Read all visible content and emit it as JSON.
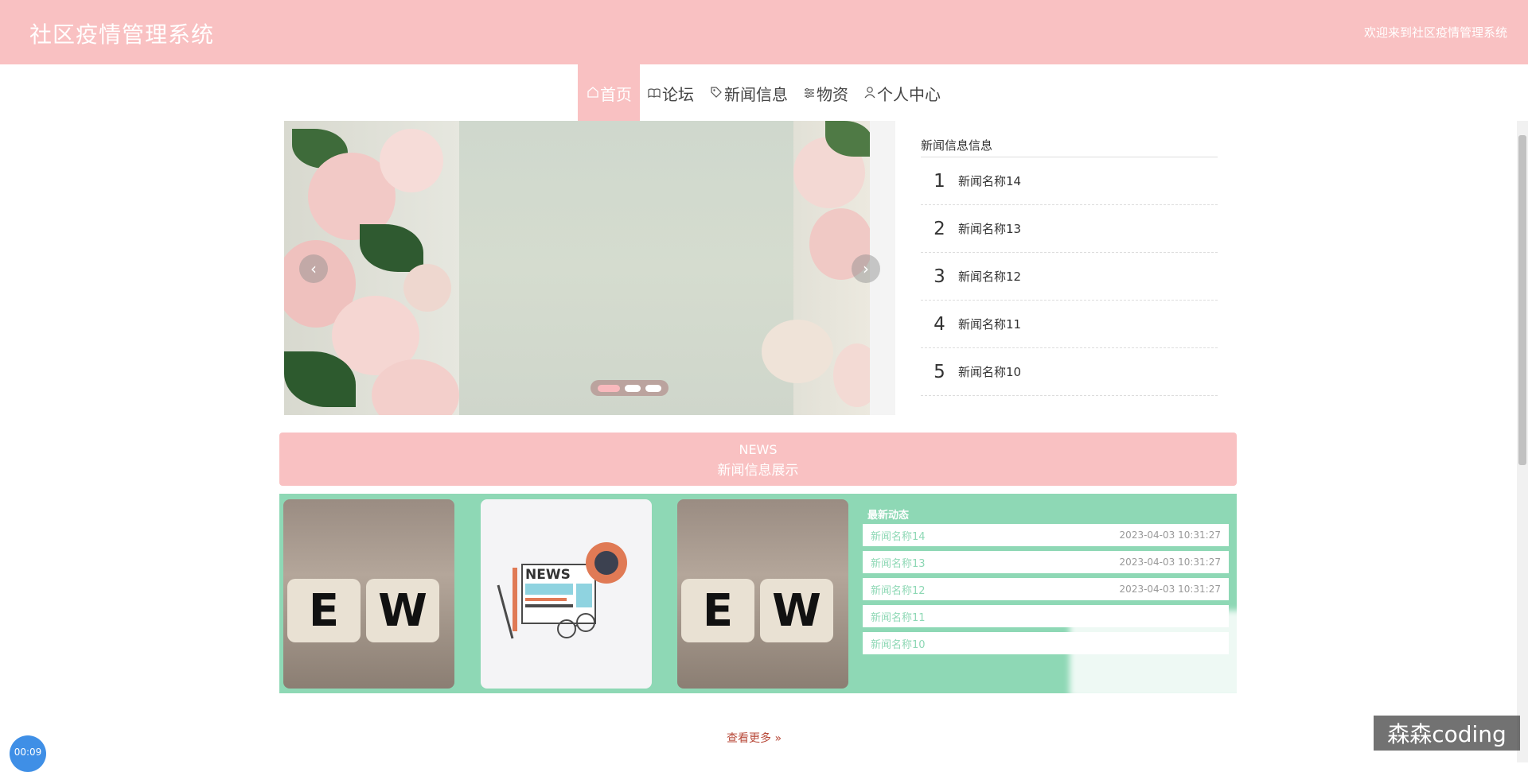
{
  "header": {
    "title": "社区疫情管理系统",
    "welcome": "欢迎来到社区疫情管理系统"
  },
  "nav": {
    "items": [
      {
        "label": "首页",
        "icon": "home-icon",
        "active": true
      },
      {
        "label": "论坛",
        "icon": "book-icon"
      },
      {
        "label": "新闻信息",
        "icon": "tag-icon"
      },
      {
        "label": "物资",
        "icon": "sliders-icon"
      },
      {
        "label": "个人中心",
        "icon": "user-icon"
      }
    ]
  },
  "carousel": {
    "prev": "‹",
    "next": "›",
    "slide_count": 3,
    "active_slide": 1
  },
  "news_list": {
    "title": "新闻信息信息",
    "items": [
      {
        "num": "1",
        "name": "新闻名称14"
      },
      {
        "num": "2",
        "name": "新闻名称13"
      },
      {
        "num": "3",
        "name": "新闻名称12"
      },
      {
        "num": "4",
        "name": "新闻名称11"
      },
      {
        "num": "5",
        "name": "新闻名称10"
      }
    ]
  },
  "banner": {
    "en": "NEWS",
    "cn": "新闻信息展示"
  },
  "cards": {
    "cube_letters": [
      "E",
      "W"
    ],
    "paper_label": "NEWS"
  },
  "latest": {
    "title": "最新动态",
    "items": [
      {
        "name": "新闻名称14",
        "time": "2023-04-03 10:31:27"
      },
      {
        "name": "新闻名称13",
        "time": "2023-04-03 10:31:27"
      },
      {
        "name": "新闻名称12",
        "time": "2023-04-03 10:31:27"
      },
      {
        "name": "新闻名称11",
        "time": ""
      },
      {
        "name": "新闻名称10",
        "time": ""
      }
    ]
  },
  "more": "查看更多",
  "overlays": {
    "watermark": "森森coding",
    "timer": "00:09"
  },
  "colors": {
    "pink": "#f9c1c2",
    "green": "#8ed8b5"
  }
}
